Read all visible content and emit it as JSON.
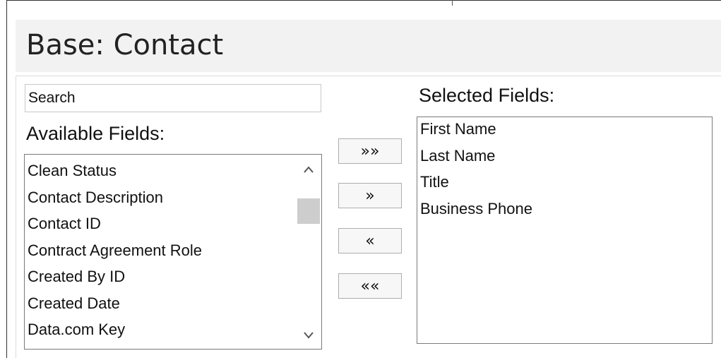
{
  "header": {
    "title": "Base: Contact"
  },
  "search": {
    "placeholder": "Search",
    "value": ""
  },
  "available": {
    "label": "Available Fields:",
    "items": [
      "Clean Status",
      "Contact Description",
      "Contact ID",
      "Contract Agreement Role",
      "Created By ID",
      "Created Date",
      "Data.com Key"
    ],
    "scroll_position": 0.15
  },
  "buttons": {
    "add_all": "»»",
    "add": "»",
    "remove": "«",
    "remove_all": "««"
  },
  "selected": {
    "label": "Selected Fields:",
    "items": [
      "First Name",
      "Last Name",
      "Title",
      "Business Phone"
    ]
  },
  "icons": {
    "scroll_up": "chevron-up-icon",
    "scroll_down": "chevron-down-icon"
  }
}
